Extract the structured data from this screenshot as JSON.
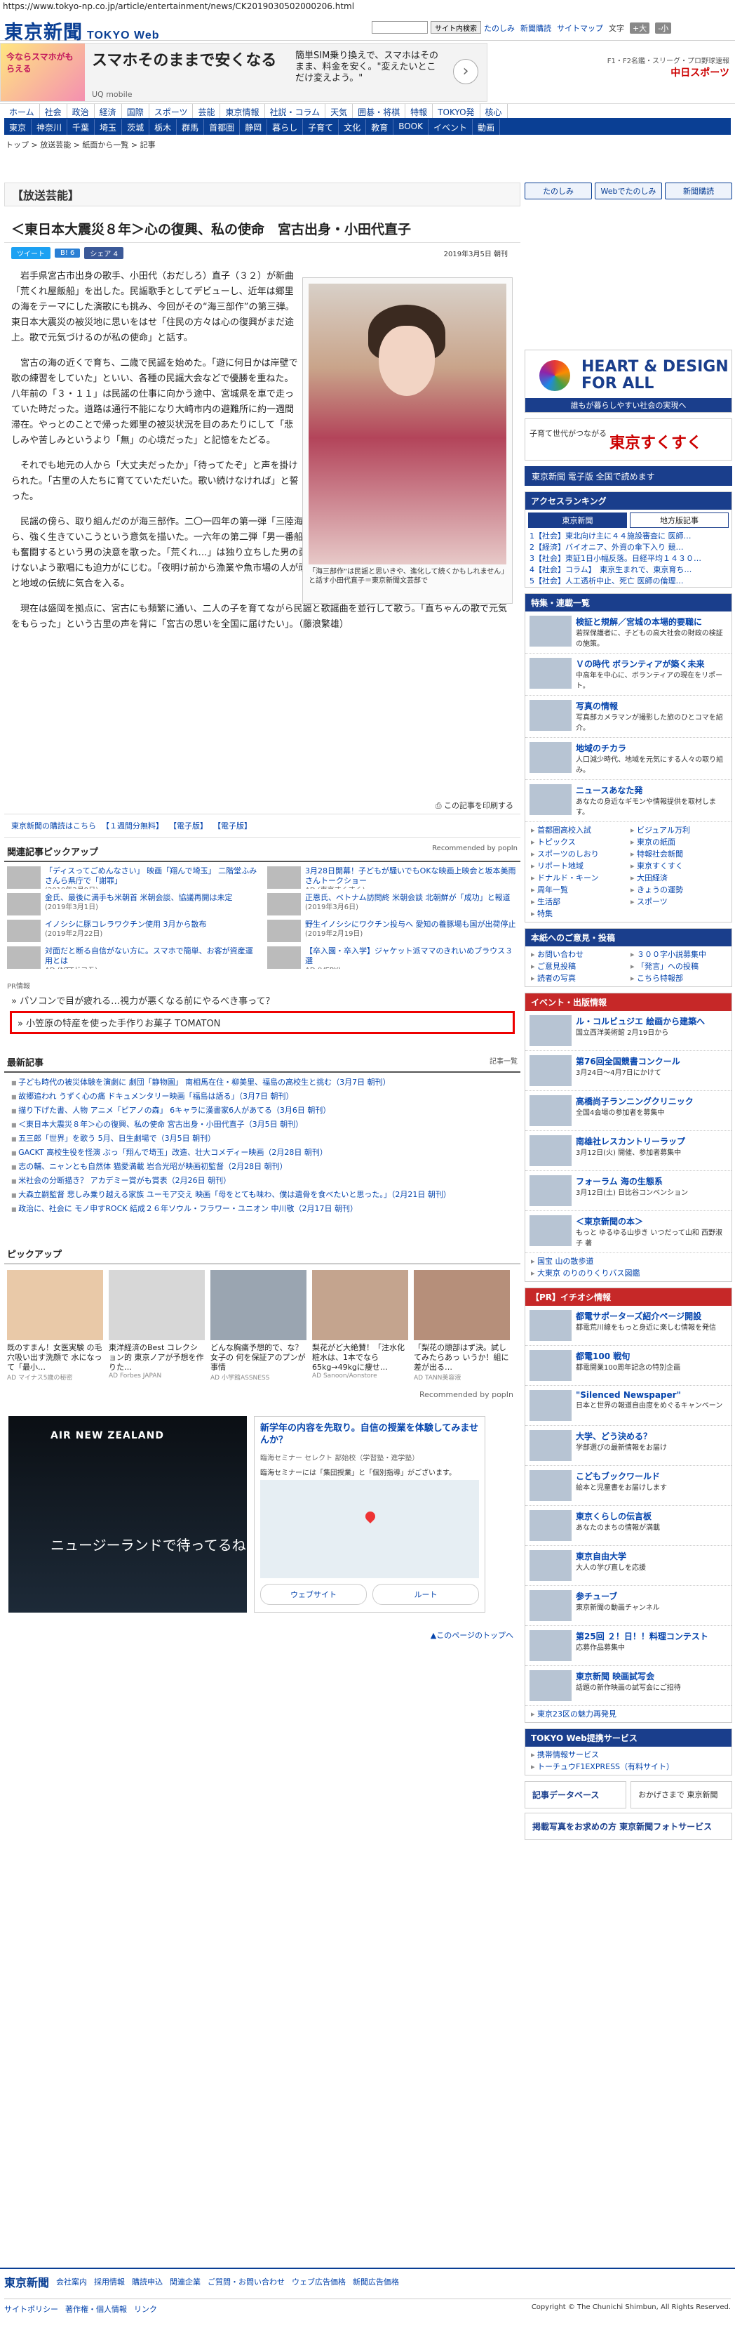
{
  "url": "https://www.tokyo-np.co.jp/article/entertainment/news/CK2019030502000206.html",
  "header": {
    "logo": "東京新聞",
    "logo_sub": "TOKYO Web",
    "search_button": "サイト内検索",
    "links": [
      "たのしみ",
      "新聞購読",
      "サイトマップ"
    ],
    "font_label": "文字",
    "font_large": "+大",
    "font_small": "-小"
  },
  "top_ad": {
    "brand": "今ならスマホがもらえる",
    "headline": "スマホそのままで安くなる",
    "sub": "UQ mobile",
    "copy": "簡単SIM乗り換えで、スマホはそのまま、料金を安く。\"変えたいとこだけ変えよう。\"",
    "arrow": "›"
  },
  "chunichi": {
    "line": "F1・F2名鑑・スリーグ・プロ野球速報",
    "brand": "中日スポーツ"
  },
  "nav1": [
    "ホーム",
    "社会",
    "政治",
    "経済",
    "国際",
    "スポーツ",
    "芸能",
    "東京情報",
    "社説・コラム",
    "天気",
    "囲碁・将棋",
    "特報",
    "TOKYO発",
    "核心"
  ],
  "nav2": [
    "東京",
    "神奈川",
    "千葉",
    "埼玉",
    "茨城",
    "栃木",
    "群馬",
    "首都圏",
    "静岡",
    "暮らし",
    "子育て",
    "文化",
    "教育",
    "BOOK",
    "イベント",
    "動画"
  ],
  "breadcrumb": "トップ > 放送芸能 > 紙面から一覧 > 記事",
  "article": {
    "category": "【放送芸能】",
    "title": "＜東日本大震災８年＞心の復興、私の使命　宮古出身・小田代直子",
    "share": [
      "ツイート",
      "B! 6",
      "シェア 4"
    ],
    "date": "2019年3月5日 朝刊",
    "paragraphs": [
      "岩手県宮古市出身の歌手、小田代（おだしろ）直子（３２）が新曲「荒くれ屋飯船」を出した。民謡歌手としてデビューし、近年は郷里の海をテーマにした演歌にも挑み、今回がその“海三部作”の第三弾。東日本大震災の被災地に思いをはせ「住民の方々は心の復興がまだ途上。歌で元気づけるのが私の使命」と話す。",
      "宮古の海の近くで育ち、二歳で民謡を始めた。「遊に何日かは岸壁で歌の練習をしていた」といい、各種の民謡大会などで優勝を重ねた。八年前の「３・１１」は民謡の仕事に向かう途中、宮城県を車で走っていた時だった。道路は通行不能になり大崎市内の避難所に約一週間滞在。やっとのことで帰った郷里の被災状況を目のあたりにして「悲しみや苦しみというより「無」の心境だった」と記憶をたどる。",
      "それでも地元の人から「大丈夫だったか」「待ってたぞ」と声を掛けられた。「古里の人たちに育てていただいた。歌い続けなければ」と誓った。",
      "民謡の傍ら、取り組んだのが海三部作。二〇一四年の第一弾「三陸海港（みなと）」は、津波でくじけた仲間を思いながら、強く生きていこうという意気を描いた。一六年の第二弾「男一番船」は、父から継いだ船で漁に出て、捕鯨者のためにも奮闘するという男の決意を歌った。「荒くれ…」は独り立ちした男の勇壮な姿がテーマだ。力強い歌詞、メロディーに負けないよう歌唱にも迫力がにじむ。「夜明け前から漁業や魚市場の人が頑張っていることは知っている。イメージできる」と地域の伝統に気合を入る。",
      "現在は盛岡を拠点に、宮古にも頻繁に通い、二人の子を育てながら民謡と歌謡曲を並行して歌う。「直ちゃんの歌で元気をもらった」という古里の声を背に「宮古の思いを全国に届けたい」。（藤浪繁雄）"
    ],
    "photo_caption": "「海三部作“は民謡と思いきや、進化して続くかもしれません」と話す小田代直子＝東京新聞文芸部で",
    "print_label": "この記事を印刷する",
    "tag_links": [
      "東京新聞の購読はこちら",
      "【１週間分無料】",
      "【電子版】",
      "【電子版】"
    ]
  },
  "related": {
    "title": "関連記事ピックアップ",
    "recommended": "Recommended by popIn",
    "items": [
      {
        "text": "「ディスってごめんなさい」 映画「翔んで埼玉」 二階堂ふみさんら県庁で「謝罪」",
        "meta": "(2019年2月9日)"
      },
      {
        "text": "3月28日開幕！子どもが騒いでもOKな映画上映会と坂本美雨さんトークショー",
        "meta": "AD (東京すくすく)"
      },
      {
        "text": "金氏、最後に満手も米朝首 米朝会談、協議再開は未定",
        "meta": "(2019年3月1日)"
      },
      {
        "text": "正恩氏、ベトナム訪問終 米朝会談 北朝鮮が「成功」と報道",
        "meta": "(2019年3月6日)"
      },
      {
        "text": "イノシシに豚コレラワクチン使用 3月から散布",
        "meta": "(2019年2月22日)"
      },
      {
        "text": "野生イノシシにワクチン投与へ 愛知の養豚場も国が出荷停止",
        "meta": "(2019年2月19日)"
      },
      {
        "text": "対面だと断る自信がない方に。スマホで簡単、お客が資産運用とは",
        "meta": "AD (NTTドコモ)"
      },
      {
        "text": "【卒入園・卒入学】ジャケット派ママのきれいめブラウス３選",
        "meta": "AD (VERY)"
      }
    ]
  },
  "pr": {
    "label": "PR情報",
    "line1": "パソコンで目が疲れる…視力が悪くなる前にやるべき事って？",
    "line2": "小笠原の特産を使った手作りお菓子 TOMATON"
  },
  "latest": {
    "title": "最新記事",
    "more": "記事一覧",
    "items": [
      "子ども時代の被災体験を演劇に 劇団「静物園」 南相馬在住・柳美里、福島の高校生と挑む（3月7日 朝刊）",
      "故郷追われ うずく心の痛 ドキュメンタリー映画「福島は語る」（3月7日 朝刊）",
      "描り下げた書、人物 アニメ「ピアノの森」 6キャラに漢書家6人があてる（3月6日 朝刊）",
      "＜東日本大震災８年＞心の復興、私の使命 宮古出身・小田代直子（3月5日 朝刊）",
      "五三郎「世界」を歌う 5月、日生劇場で（3月5日 朝刊）",
      "GACKT 高校生役を怪演 ぶっ「翔んで埼玉」改造、壮大コメディー映画（2月28日 朝刊）",
      "志の輔、ニャンとも自然体 猫愛満載 岩合光昭が映画初監督（2月28日 朝刊）",
      "米社会の分断描き？ アカデミー賞がも賞表（2月26日 朝刊）",
      "大森立嗣監督 悲しみ乗り越える家族 ユーモア交え 映画「母をとても味わ、僕は遺骨を食べたいと思った。」（2月21日 朝刊）",
      "政治に、社会に モノ申すROCK 結成２６年ソウル・フラワー・ユニオン 中川敬（2月17日 朝刊）"
    ]
  },
  "pickup": {
    "title": "ピックアップ",
    "items": [
      {
        "t": "既のすまん！女医実験 の毛穴吸い出す洗顔で 水になって「最小…",
        "s": "AD マイナス5歳の秘密"
      },
      {
        "t": "東洋経済のBest コレクション的 東京ノアが予想を作りた…",
        "s": "AD Forbes JAPAN"
      },
      {
        "t": "どんな胸痛予想的で、な？女子の 何を保証アのプンが事情",
        "s": "AD 小学館ASSNESS"
      },
      {
        "t": "梨花がど大絶賛！「注水化粧水は、1本でなら65kg→49kgに痩せ…",
        "s": "AD Sanoon/Aonstore"
      },
      {
        "t": "「梨花の頭部はず決。試してみたらあっ いうか！組に差が出る…",
        "s": "AD TANN美容液"
      }
    ],
    "recommended": "Recommended by popIn"
  },
  "bigad": {
    "brand": "AIR NEW ZEALAND",
    "copy": "ニュージーランドで待ってるね",
    "map_head": "新学年の内容を先取り。自信の授業を体験してみませんか？",
    "map_sub": "臨海セミナー セレクト 部始校（学習塾・進学塾）",
    "map_badge": "臨海セミナーには「集団授業」と「個別指導」がございます。",
    "web": "ウェブサイト",
    "route": "ルート"
  },
  "to_top": "▲このページのトップへ",
  "side": {
    "btns": [
      "たのしみ",
      "Webでたのしみ",
      "新聞購読"
    ],
    "hd_title": "HEART & DESIGN FOR ALL",
    "hd_sub": "誰もが暮らしやすい社会の実現へ",
    "sk_text": "子育て世代がつながる",
    "sk_brand": "東京すくすく",
    "digi": "東京新聞 電子版 全国で読めます",
    "rank_title": "アクセスランキング",
    "rank_tabs": [
      "東京新聞",
      "地方版記事"
    ],
    "rank_items": [
      "1【社会】東北向け主に４４施設審査に 医師…",
      "2【経済】バイオニア、外資の傘下入り 競…",
      "3【社会】東証1日小幅反落。日経平均１４３０…",
      "4【社会】コラム】　東京生まれで、東京育ち…",
      "5【社会】人工透析中止、死亡 医師の倫理…"
    ],
    "feature_title": "特集・連載一覧",
    "features": [
      {
        "t": "検証と規解／宮城の本場的要職に",
        "s": "若探保護者に、子どもの高大社会の財政の検証の施策。"
      },
      {
        "t": "Ｖの時代 ボランティアが築く未来",
        "s": "中高年を中心に、ボランティアの現在をリポート。"
      },
      {
        "t": "写真の情報",
        "s": "写真部カメラマンが撮影した旅のひとコマを紹介。"
      },
      {
        "t": "地域のチカラ",
        "s": "人口減少時代、地域を元気にする人々の取り組み。"
      },
      {
        "t": "ニュースあなた発",
        "s": "あなたの身近なギモンや情報提供を取材します。"
      }
    ],
    "guide": [
      "首都圏高校入試",
      "ビジュアル万利",
      "トピックス",
      "東京の紙面",
      "スポーツのしおり",
      "特報社会新聞",
      "リポート地域",
      "東京すくすく",
      "ドナルド・キーン",
      "大田経済",
      "周年一覧",
      "きょうの運勢",
      "生活部",
      "スポーツ",
      "特集"
    ],
    "reader_title": "本紙へのご意見・投稿",
    "reader": [
      "お問い合わせ",
      "３００字小説募集中",
      "ご意見投稿",
      "「発言」への投稿",
      "読者の写真",
      "こちら特報部"
    ],
    "event_title": "イベント・出版情報",
    "events": [
      {
        "t": "ル・コルビュジエ 絵画から建築へ",
        "s": "国立西洋美術館 2月19日から"
      },
      {
        "t": "第76回全国競書コンクール",
        "s": "3月24日～4月7日にかけて"
      },
      {
        "t": "高橋尚子ランニングクリニック",
        "s": "全国4会場の参加者を募集中"
      },
      {
        "t": "南雄社レスカントリーラップ",
        "s": "3月12日(火) 開催、参加者募集中"
      },
      {
        "t": "フォーラム 海の生態系",
        "s": "3月12日(土) 日比谷コンベンション"
      },
      {
        "t": "＜東京新聞の本＞",
        "s": "もっと ゆるゆる山歩き いつだって山和 西野淑子 著"
      }
    ],
    "small_links": [
      "国宝 山の散歩道",
      "大東京 のりのりくりバス図鑑"
    ],
    "ion_title": "【PR】イチオシ情報",
    "ions": [
      {
        "t": "都電サポーターズ紹介ページ開設",
        "s": "都電荒川線をもっと身近に楽しむ情報を発信"
      },
      {
        "t": "都電100 戦旬",
        "s": "都電開業100周年記念の特別企画"
      },
      {
        "t": "\"Silenced Newspaper\"",
        "s": "日本と世界の報道自由度をめぐるキャンペーン"
      },
      {
        "t": "大学、どう決める？",
        "s": "学部選びの最新情報をお届け"
      },
      {
        "t": "こどもブックワールド",
        "s": "絵本と児童書をお届けします"
      },
      {
        "t": "東京くらしの伝言板",
        "s": "あなたのまちの情報が満載"
      },
      {
        "t": "東京自由大学",
        "s": "大人の学び直しを応援"
      },
      {
        "t": "参チューブ",
        "s": "東京新聞の動画チャンネル"
      },
      {
        "t": "第25回 ２！日！！料理コンテスト",
        "s": "応募作品募集中"
      },
      {
        "t": "東京新聞 映画試写会",
        "s": "話題の新作映画の試写会にご招待"
      }
    ],
    "tokyo23": "東京23区の魅力再発見",
    "service_title": "TOKYO Web提携サービス",
    "services": [
      "携帯情報サービス",
      "トーチュウF1EXPRESS（有料サイト）"
    ],
    "db": "記事データベース",
    "db2": "おかげさまで 東京新聞",
    "photo_service": "掲載写真をお求めの方 東京新聞フォトサービス"
  },
  "footer": {
    "logo": "東京新聞",
    "links": [
      "会社案内",
      "採用情報",
      "購読申込",
      "関連企業",
      "ご質問・お問い合わせ",
      "ウェブ広告価格",
      "新聞広告価格"
    ],
    "links2": [
      "サイトポリシー",
      "著作権・個人情報",
      "リンク"
    ],
    "copyright": "Copyright © The Chunichi Shimbun, All Rights Reserved."
  }
}
